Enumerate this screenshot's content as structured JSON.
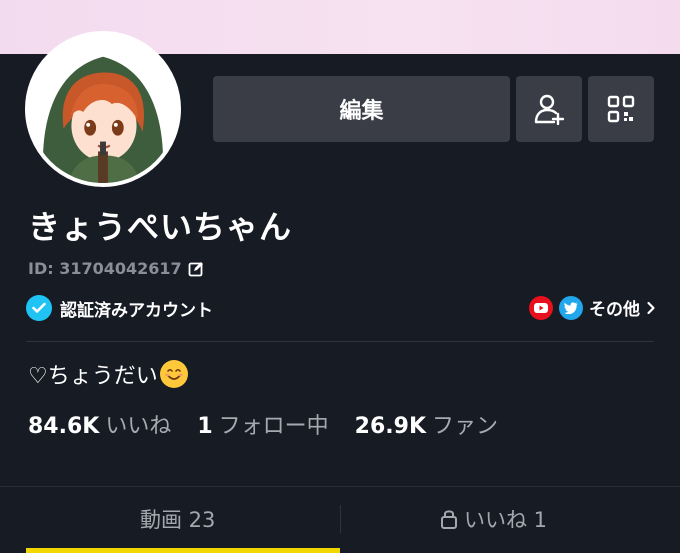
{
  "header": {
    "band_color": "#f4dcee"
  },
  "buttons": {
    "edit_label": "編集",
    "add_friend_icon": "add-person-icon",
    "qr_icon": "qr-code-icon"
  },
  "profile": {
    "display_name": "きょうぺいちゃん",
    "user_id": "ID: 31704042617",
    "verified_label": "認証済みアカウント",
    "verified_color": "#20c4f4",
    "other_links_label": "その他",
    "bio_text": "♡ちょうだい"
  },
  "stats": [
    {
      "value": "84.6K",
      "label": "いいね"
    },
    {
      "value": "1",
      "label": "フォロー中"
    },
    {
      "value": "26.9K",
      "label": "ファン"
    }
  ],
  "tabs": {
    "videos_label": "動画 23",
    "likes_label": "いいね 1",
    "active_color": "#f2d600"
  }
}
